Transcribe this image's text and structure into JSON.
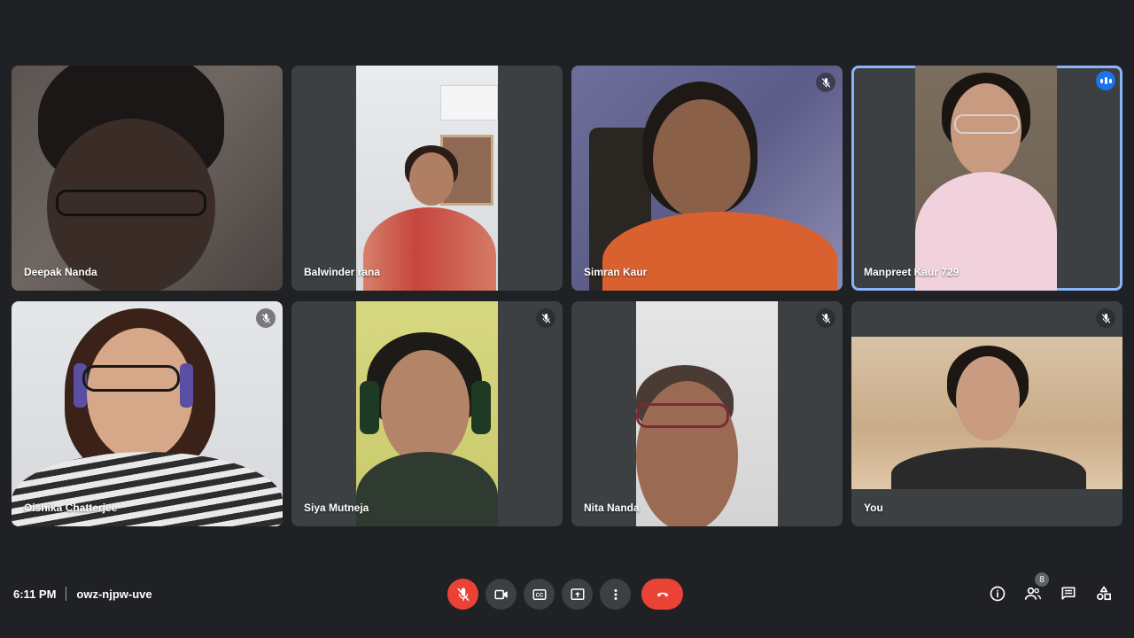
{
  "participants": [
    {
      "name": "Deepak Nanda",
      "muted": false
    },
    {
      "name": "Balwinder rana",
      "muted": false
    },
    {
      "name": "Simran Kaur",
      "muted": true
    },
    {
      "name": "Manpreet Kaur 729",
      "muted": false,
      "speaking": true
    },
    {
      "name": "Oishika Chatterjee",
      "muted": true
    },
    {
      "name": "Siya Mutneja",
      "muted": true
    },
    {
      "name": "Nita Nanda",
      "muted": true
    },
    {
      "name": "You",
      "muted": true
    }
  ],
  "meeting": {
    "time": "6:11 PM",
    "code": "owz-njpw-uve"
  },
  "controls": [
    "mic-off-icon",
    "camera-icon",
    "captions-icon",
    "present-icon",
    "more-options-icon",
    "end-call-icon"
  ],
  "right_panel": {
    "participant_count": "8",
    "icons": [
      "info-icon",
      "people-icon",
      "chat-icon",
      "activities-icon"
    ]
  },
  "colors": {
    "background": "#202124",
    "tile": "#3c4043",
    "accent": "#8ab4f8",
    "end_call": "#ea4335"
  }
}
